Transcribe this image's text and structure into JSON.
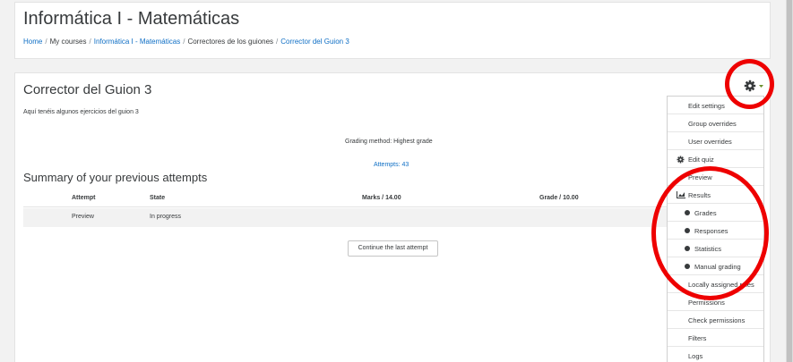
{
  "header": {
    "course_title": "Informática I - Matemáticas",
    "breadcrumb": [
      "Home",
      "My courses",
      "Informática I - Matemáticas",
      "Correctores de los guiones",
      "Corrector del Guion 3"
    ],
    "breadcrumb_sep": "/"
  },
  "quiz": {
    "title": "Corrector del Guion 3",
    "intro": "Aquí tenéis algunos ejercicios del guion 3",
    "grading_method": "Grading method: Highest grade",
    "attempts_link": "Attempts: 43"
  },
  "summary": {
    "title": "Summary of your previous attempts",
    "columns": [
      "Attempt",
      "State",
      "Marks / 14.00",
      "Grade / 10.00"
    ],
    "rows": [
      [
        "Preview",
        "In progress",
        "",
        ""
      ]
    ]
  },
  "continue_button": "Continue the last attempt",
  "settings_menu": {
    "items": [
      "Edit settings",
      "Group overrides",
      "User overrides",
      "Edit quiz",
      "Preview",
      "Results",
      "Grades",
      "Responses",
      "Statistics",
      "Manual grading",
      "Locally assigned roles",
      "Permissions",
      "Check permissions",
      "Filters",
      "Logs"
    ],
    "icons": [
      "",
      "",
      "",
      "gear-icon",
      "",
      "chart-icon",
      "bullet-icon",
      "bullet-icon",
      "bullet-icon",
      "bullet-icon",
      "",
      "",
      "",
      "",
      ""
    ]
  },
  "colors": {
    "link": "#0f6fc5",
    "annotation": "#ee0000",
    "background": "#f2f2f2"
  }
}
